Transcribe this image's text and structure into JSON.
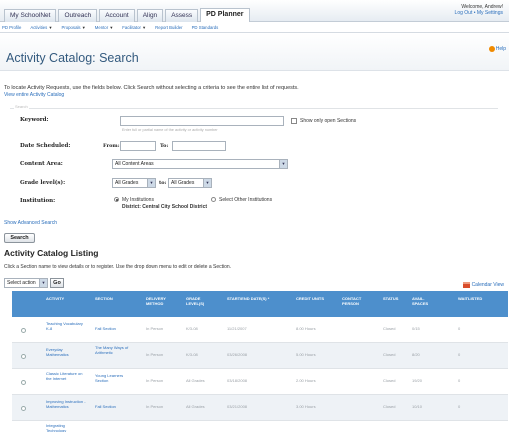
{
  "tabs": [
    "My SchoolNet",
    "Outreach",
    "Account",
    "Align",
    "Assess",
    "PD Planner"
  ],
  "header": {
    "welcome": "Welcome, Andrew!",
    "logout": "Log Out • My Settings"
  },
  "subnav": [
    "PD Profile",
    "Activities",
    "Proposals",
    "Mentor",
    "Facilitator",
    "Report Builder",
    "PD Standards"
  ],
  "page": {
    "title": "Activity Catalog: Search",
    "help": "Help"
  },
  "intro": "To locate Activity Requests, use the fields below. Click Search without selecting a criteria to see the entire list of requests.",
  "view_all": "View entire Activity Catalog",
  "form": {
    "legend": "Search",
    "keyword_label": "Keyword:",
    "keyword_hint": "Enter full or partial name of the activity or activity number",
    "open_sections": "Show only open Sections",
    "date_label": "Date Scheduled:",
    "from": "From:",
    "to": "To:",
    "content_label": "Content Area:",
    "content_value": "All Content Areas",
    "grade_label": "Grade level(s):",
    "grade_from": "All Grades",
    "grade_to_word": "to:",
    "grade_to": "All Grades",
    "inst_label": "Institution:",
    "my_inst": "My Institutions",
    "district": "District: Central City School District",
    "other_inst": "Select Other Institutions"
  },
  "advanced": "Show Advanced Search",
  "search_button": "Search",
  "listing": {
    "title": "Activity Catalog Listing",
    "intro": "Click a Section name to view details or to register. Use the drop down menu to edit or delete a Section.",
    "select_action": "Select action",
    "go": "Go",
    "calendar": "Calendar View"
  },
  "table": {
    "headers": [
      "ACTIVITY",
      "SECTION",
      "DELIVERY METHOD",
      "GRADE LEVEL(S)",
      "START/END DATE(S) *",
      "CREDIT UNITS",
      "CONTACT PERSON",
      "STATUS",
      "AVAIL. SPACES",
      "WAITLISTED"
    ],
    "rows": [
      [
        "Teaching Vocabulary K-8",
        "Fall Section",
        "In Person",
        "K/3-08",
        "11/21/2007",
        "8.00 Hours",
        "",
        "Closed",
        "0/15",
        "0"
      ],
      [
        "Everyday Mathematics",
        "The Many Ways of Arithmetic",
        "In Person",
        "K/3-08",
        "03/26/2008",
        "5.00 Hours",
        "",
        "Closed",
        "8/20",
        "0"
      ],
      [
        "Classic Literature on the Internet",
        "Young Learners Section",
        "In Person",
        "All Grades",
        "03/18/2008",
        "2.00 Hours",
        "",
        "Closed",
        "19/20",
        "0"
      ],
      [
        "Improving Instruction - Mathematics",
        "Fall Section",
        "In Person",
        "All Grades",
        "03/21/2008",
        "3.00 Hours",
        "",
        "Closed",
        "10/10",
        "0"
      ],
      [
        "Integrating Technology",
        "",
        "",
        "",
        "",
        "",
        "",
        "",
        "",
        ""
      ]
    ]
  }
}
